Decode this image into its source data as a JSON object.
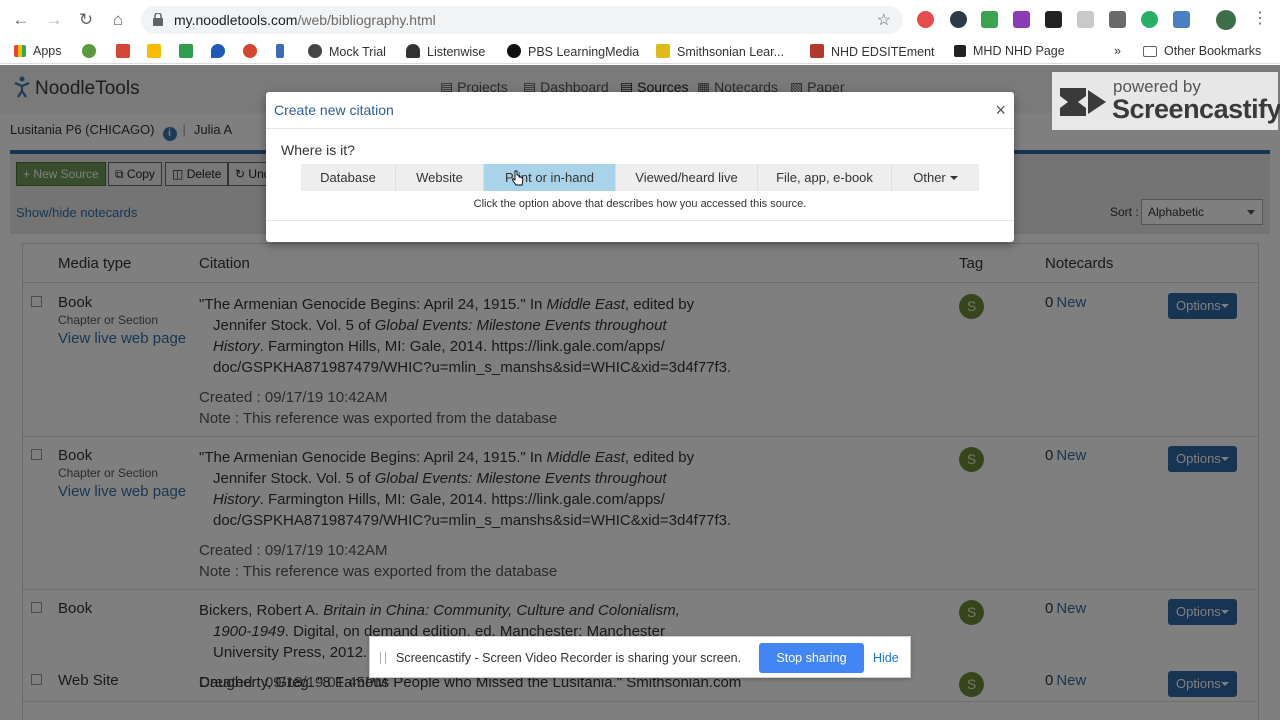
{
  "browser": {
    "url_host": "my.noodletools.com",
    "url_path": "/web/bibliography.html",
    "bookmarks": [
      "Apps",
      "Mock Trial",
      "Listenwise",
      "PBS LearningMedia",
      "Smithsonian Lear...",
      "NHD EDSITEment",
      "MHD NHD Page",
      "»",
      "Other Bookmarks"
    ]
  },
  "site": {
    "logo": "NoodleTools",
    "tabs": [
      "Projects",
      "Dashboard",
      "Sources",
      "Notecards",
      "Paper"
    ],
    "project_name": "Lusitania P6  (CHICAGO)",
    "student": "Julia A",
    "toolbar": {
      "new_source": "+ New Source",
      "copy": "Copy",
      "delete": "Delete",
      "undo": "Und",
      "show_hide": "Show/hide notecards",
      "sort_label": "Sort :",
      "sort_value": "Alphabetic"
    }
  },
  "list": {
    "headers": {
      "media": "Media type",
      "citation": "Citation",
      "tag": "Tag",
      "notecards": "Notecards"
    },
    "rows": [
      {
        "media": "Book",
        "sub": "Chapter or Section",
        "link": "View live web page",
        "lines": [
          "\"The Armenian Genocide Begins: April 24, 1915.\" In <i>Middle East</i>, edited by",
          "Jennifer Stock. Vol. 5 of <i>Global Events: Milestone Events throughout</i>",
          "<i>History</i>. Farmington Hills, MI: Gale, 2014. https://link.gale.com/apps/",
          "doc/GSPKHA871987479/WHIC?u=mlin_s_manshs&amp;sid=WHIC&amp;xid=3d4f77f3."
        ],
        "created": "Created : 09/17/19 10:42AM",
        "note": "Note : This reference was exported from the database",
        "tag": "S",
        "count": "0",
        "new": "New",
        "options": "Options"
      },
      {
        "media": "Book",
        "sub": "Chapter or Section",
        "link": "View live web page",
        "lines": [
          "\"The Armenian Genocide Begins: April 24, 1915.\" In <i>Middle East</i>, edited by",
          "Jennifer Stock. Vol. 5 of <i>Global Events: Milestone Events throughout</i>",
          "<i>History</i>. Farmington Hills, MI: Gale, 2014. https://link.gale.com/apps/",
          "doc/GSPKHA871987479/WHIC?u=mlin_s_manshs&amp;sid=WHIC&amp;xid=3d4f77f3."
        ],
        "created": "Created : 09/17/19 10:42AM",
        "note": "Note : This reference was exported from the database",
        "tag": "S",
        "count": "0",
        "new": "New",
        "options": "Options"
      },
      {
        "media": "Book",
        "sub": "",
        "link": "",
        "lines": [
          "Bickers, Robert A. <i>Britain in China: Community, Culture and Colonialism,</i>",
          "<i>1900-1949</i>. Digital, on demand edition. ed. Manchester: Manchester",
          "University Press, 2012."
        ],
        "created": "Created : 09/18/19 01:45PM",
        "note": "",
        "tag": "S",
        "count": "0",
        "new": "New",
        "options": "Options"
      },
      {
        "media": "Web Site",
        "sub": "",
        "link": "",
        "lines": [
          "Daugherty, Greg. \"8 Famous People who Missed the Lusitania.\" Smithsonian.com"
        ],
        "created": "",
        "note": "",
        "tag": "S",
        "count": "0",
        "new": "New",
        "options": "Options"
      }
    ]
  },
  "modal": {
    "title": "Create new citation",
    "close": "×",
    "question": "Where is it?",
    "options": [
      "Database",
      "Website",
      "Print or in-hand",
      "Viewed/heard live",
      "File, app, e-book",
      "Other"
    ],
    "hint": "Click the option above that describes how you accessed this source."
  },
  "watermark": {
    "powered": "powered by",
    "brand": "Screencastify"
  },
  "share": {
    "message": "Screencastify - Screen Video Recorder is sharing your screen.",
    "stop": "Stop sharing",
    "hide": "Hide"
  },
  "colors": {
    "accent_blue": "#2b6aa6",
    "tag_green": "#6e8a36",
    "highlight": "#a9d3e8",
    "share_blue": "#4285f4"
  }
}
